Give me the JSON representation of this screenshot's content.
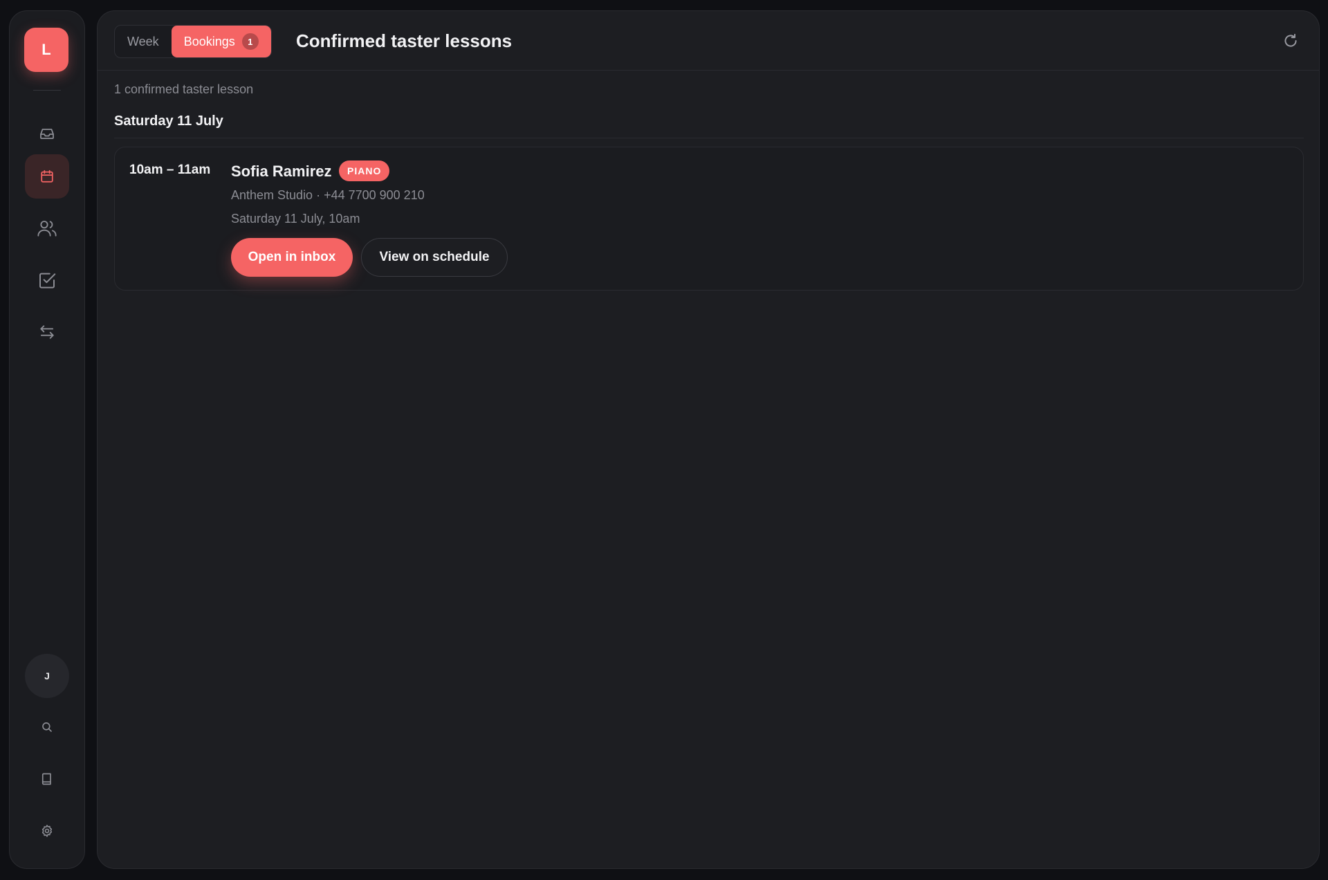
{
  "sidebar": {
    "logo_letter": "L",
    "avatar_initial": "J",
    "nav_items": [
      {
        "icon": "inbox-icon",
        "active": false
      },
      {
        "icon": "calendar-icon",
        "active": true
      },
      {
        "icon": "users-icon",
        "active": false
      },
      {
        "icon": "checkbox-icon",
        "active": false
      },
      {
        "icon": "arrows-swap-icon",
        "active": false
      }
    ],
    "bottom_items": [
      {
        "icon": "search-icon"
      },
      {
        "icon": "book-icon"
      },
      {
        "icon": "gear-icon"
      }
    ]
  },
  "header": {
    "tabs": [
      {
        "label": "Week",
        "active": false
      },
      {
        "label": "Bookings",
        "active": true,
        "count": "1"
      }
    ],
    "title": "Confirmed taster lessons"
  },
  "content": {
    "summary": "1 confirmed taster lesson",
    "day_heading": "Saturday 11 July",
    "booking": {
      "time": "10am – 11am",
      "name": "Sofia Ramirez",
      "tag": "PIANO",
      "details": "Anthem Studio · +44 7700 900 210",
      "datetime": "Saturday 11 July, 10am",
      "primary_action": "Open in inbox",
      "secondary_action": "View on schedule"
    }
  },
  "colors": {
    "accent": "#f56464",
    "background": "#1d1e22"
  }
}
